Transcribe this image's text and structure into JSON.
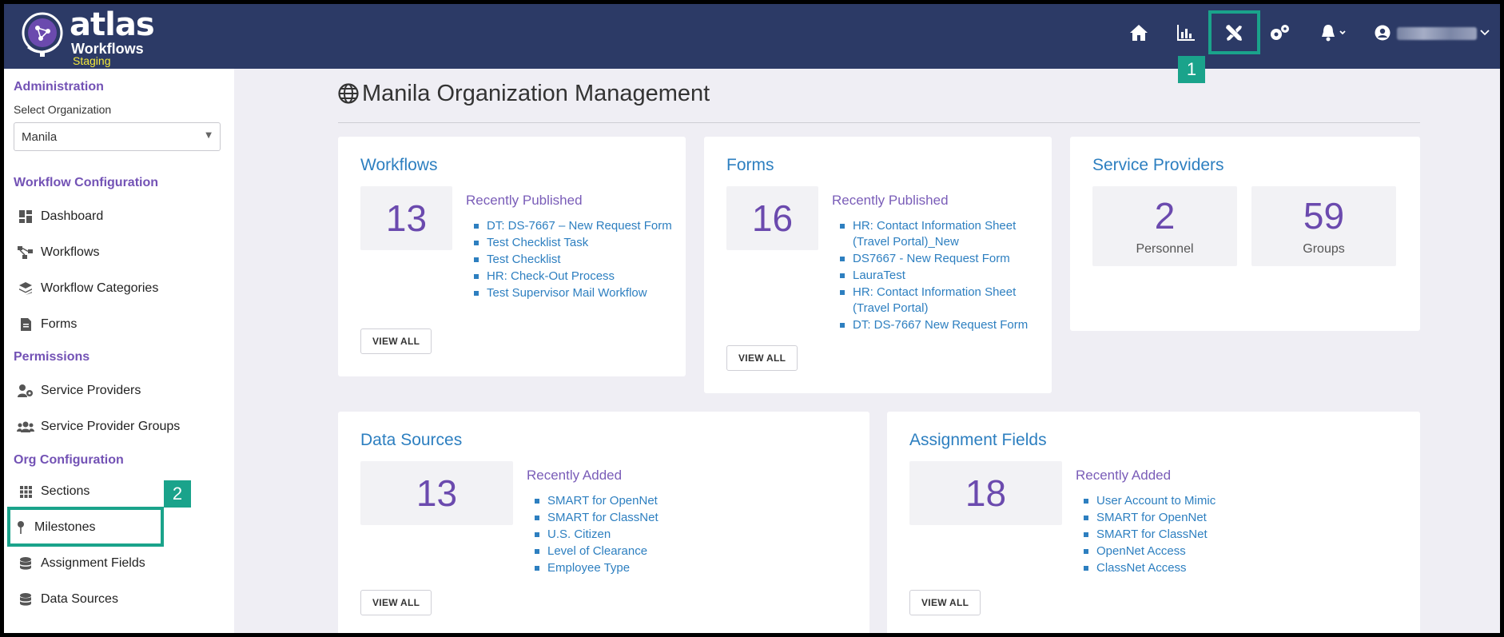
{
  "brand": {
    "name": "atlas",
    "product": "Workflows",
    "environment": "Staging",
    "env_color": "#f5e93a"
  },
  "colors": {
    "header_bg": "#2c3a66",
    "accent_purple": "#7352b5",
    "link_blue": "#2d7fc0",
    "callout_teal": "#1aa38b"
  },
  "header": {
    "icons": [
      "home-icon",
      "chart-icon",
      "tools-icon",
      "settings-gears-icon",
      "bell-icon",
      "user-icon"
    ],
    "callouts": {
      "tools": "1",
      "milestones": "2"
    }
  },
  "sidebar": {
    "administration": "Administration",
    "select_org_label": "Select Organization",
    "selected_org": "Manila",
    "workflow_config": "Workflow Configuration",
    "wf_items": [
      "Dashboard",
      "Workflows",
      "Workflow Categories",
      "Forms"
    ],
    "permissions": "Permissions",
    "perm_items": [
      "Service Providers",
      "Service Provider Groups"
    ],
    "org_config": "Org Configuration",
    "org_items": [
      "Sections",
      "Milestones",
      "Assignment Fields",
      "Data Sources"
    ]
  },
  "main": {
    "title": "Manila Organization Management",
    "workflows": {
      "title": "Workflows",
      "count": "13",
      "recent_heading": "Recently Published",
      "items": [
        "DT: DS-7667 – New Request Form",
        "Test Checklist Task",
        "Test Checklist",
        "HR: Check-Out Process",
        "Test Supervisor Mail Workflow"
      ],
      "view_all": "VIEW ALL"
    },
    "forms": {
      "title": "Forms",
      "count": "16",
      "recent_heading": "Recently Published",
      "items": [
        "HR: Contact Information Sheet (Travel Portal)_New",
        "DS7667 - New Request Form",
        "LauraTest",
        "HR: Contact Information Sheet (Travel Portal)",
        "DT: DS-7667 New Request Form"
      ],
      "view_all": "VIEW ALL"
    },
    "service_providers": {
      "title": "Service Providers",
      "personnel_count": "2",
      "personnel_label": "Personnel",
      "groups_count": "59",
      "groups_label": "Groups"
    },
    "data_sources": {
      "title": "Data Sources",
      "count": "13",
      "recent_heading": "Recently Added",
      "items": [
        "SMART for OpenNet",
        "SMART for ClassNet",
        "U.S. Citizen",
        "Level of Clearance",
        "Employee Type"
      ],
      "view_all": "VIEW ALL"
    },
    "assignment_fields": {
      "title": "Assignment Fields",
      "count": "18",
      "recent_heading": "Recently Added",
      "items": [
        "User Account to Mimic",
        "SMART for OpenNet",
        "SMART for ClassNet",
        "OpenNet Access",
        "ClassNet Access"
      ],
      "view_all": "VIEW ALL"
    }
  }
}
